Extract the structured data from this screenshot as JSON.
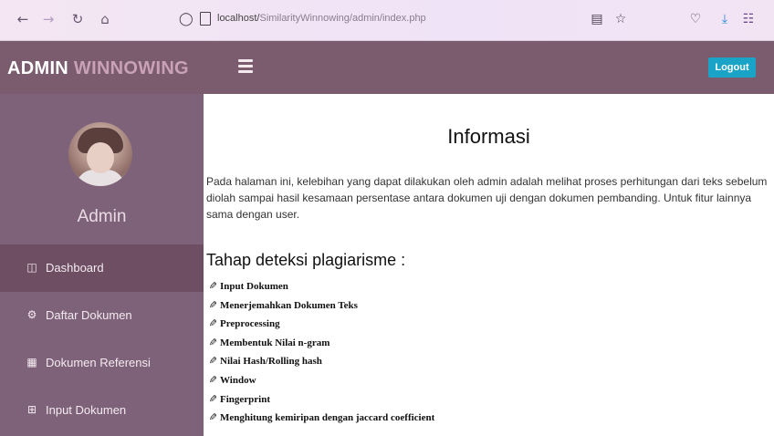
{
  "browser": {
    "url_host": "localhost/",
    "url_path": "SimilarityWinnowing/admin/index.php",
    "icons": [
      "back-arrow-icon",
      "forward-arrow-icon",
      "reload-icon",
      "home-icon",
      "shield-icon",
      "page-icon",
      "reader-view-icon",
      "bookmark-star-icon",
      "pocket-icon",
      "download-icon",
      "library-icon"
    ]
  },
  "header": {
    "brand_part1": "ADMIN",
    "brand_part2": "WINNOWING",
    "logout_label": "Logout"
  },
  "sidebar": {
    "admin_name": "Admin",
    "items": [
      {
        "label": "Dashboard",
        "icon": "monitor-icon"
      },
      {
        "label": "Daftar Dokumen",
        "icon": "cogs-icon"
      },
      {
        "label": "Dokumen Referensi",
        "icon": "book-icon"
      },
      {
        "label": "Input Dokumen",
        "icon": "table-icon"
      }
    ]
  },
  "main": {
    "title": "Informasi",
    "description": "Pada halaman ini, kelebihan yang dapat dilakukan oleh admin adalah melihat proses perhitungan dari teks sebelum diolah sampai hasil kesamaan persentase antara dokumen uji dengan dokumen pembanding. Untuk fitur lainnya sama dengan user.",
    "section_title": "Tahap deteksi plagiarisme :",
    "steps": [
      "Input Dokumen",
      "Menerjemahkan Dokumen Teks",
      "Preprocessing",
      "Membentuk Nilai n-gram",
      "Nilai Hash/Rolling hash",
      "Window",
      "Fingerprint",
      "Menghitung kemiripan dengan jaccard coefficient"
    ]
  },
  "colors": {
    "topbar": "#7b5c6f",
    "sidebar": "#7e6279",
    "sidebar_active": "#6d4e63",
    "logout": "#18a3c7",
    "brand_accent": "#c9a2b5"
  }
}
